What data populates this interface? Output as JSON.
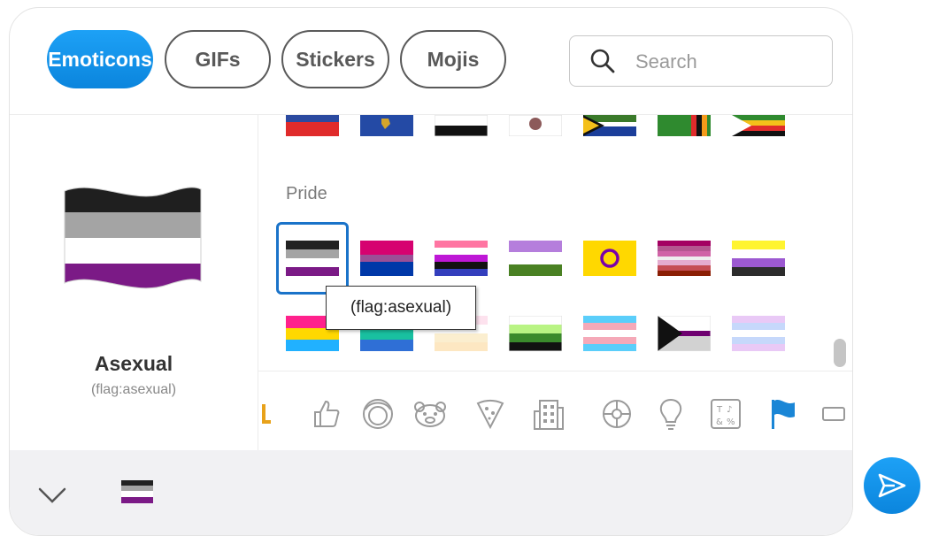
{
  "tabs": [
    {
      "label": "Emoticons",
      "active": true
    },
    {
      "label": "GIFs",
      "active": false
    },
    {
      "label": "Stickers",
      "active": false
    },
    {
      "label": "Mojis",
      "active": false
    }
  ],
  "search": {
    "placeholder": "Search",
    "value": ""
  },
  "preview": {
    "name": "Asexual",
    "code": "(flag:asexual)"
  },
  "section": {
    "title": "Pride"
  },
  "tooltip": {
    "text": "(flag:asexual)"
  },
  "categories": [
    "people-partial-icon",
    "thumbs-up-icon",
    "smiley-face-icon",
    "animal-face-icon",
    "pizza-icon",
    "building-icon",
    "ball-icon",
    "lightbulb-icon",
    "symbols-icon",
    "flag-icon",
    "more-icon"
  ],
  "colors": {
    "accent": "#0b85dd",
    "selected_border": "#1a73c9"
  }
}
